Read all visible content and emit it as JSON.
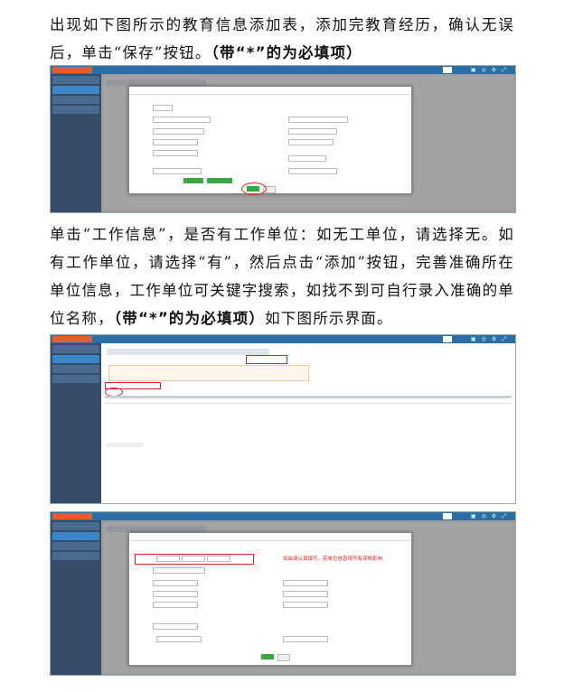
{
  "para1": {
    "text": "出现如下图所示的教育信息添加表，添加完教育经历，确认无误后，单击“保存”按钮。",
    "bold": "（带“*”的为必填项）"
  },
  "para2": {
    "text": "单击“工作信息”，是否有工作单位：如无工单位，请选择无。如有工作单位，请选择“有”，然后点击“添加”按钮，完善准确所在单位信息，工作单位可关键字搜索，如找不到可自行录入准确的单位名称，",
    "bold": "（带“*”的为必填项）",
    "tail": "如下图所示界面。"
  },
  "screenshot3": {
    "warning": "如由请认真填写，若单位信息填写有误将影响"
  }
}
